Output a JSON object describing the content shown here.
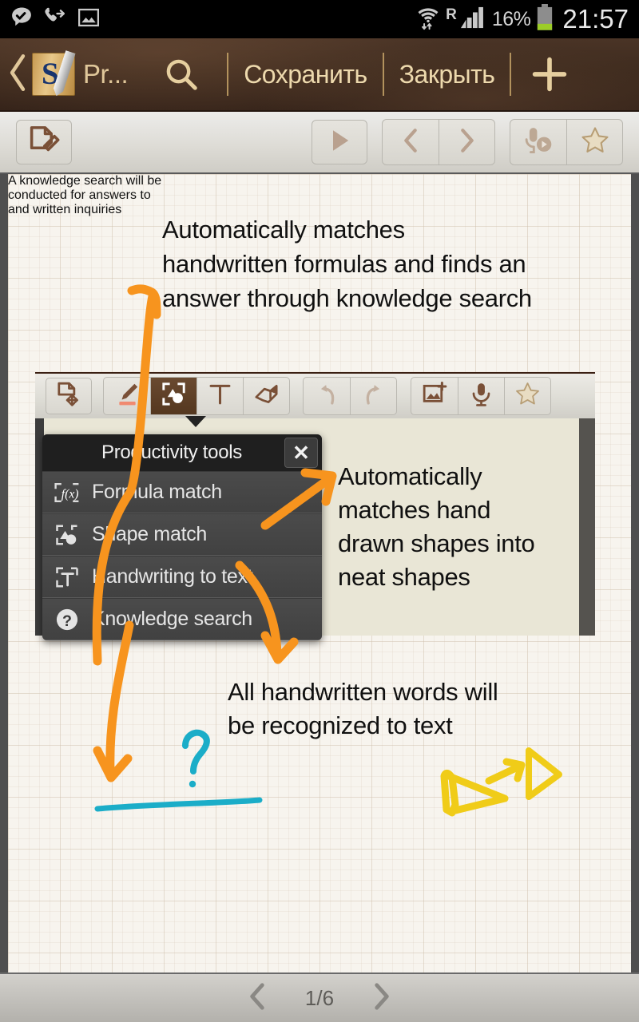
{
  "status_bar": {
    "icons_left": [
      "message-check-icon",
      "outgoing-call-icon",
      "screenshot-image-icon"
    ],
    "wifi": "wifi-transfer-icon",
    "roaming": "R",
    "signal": "signal-bars-icon",
    "battery_percent": "16%",
    "battery": "battery-low-icon",
    "time": "21:57"
  },
  "app_bar": {
    "back": "back-chevron-icon",
    "app_icon": "snote-app-icon",
    "app_letter": "S",
    "title": "Pr...",
    "search": "search-icon",
    "save_label": "Сохранить",
    "close_label": "Закрыть",
    "add": "plus-icon"
  },
  "toolbar": {
    "edit_page": "page-edit-icon",
    "play": "play-icon",
    "prev": "chevron-left-icon",
    "next": "chevron-right-icon",
    "voice_play": "voice-record-play-icon",
    "favorite": "star-icon"
  },
  "note": {
    "annotations": [
      {
        "id": "formula",
        "text": "Automatically matches\nhandwritten formulas and finds an\nanswer through knowledge search"
      },
      {
        "id": "shapes",
        "text": "Automatically\nmatches hand\ndrawn shapes into\nneat shapes"
      },
      {
        "id": "words",
        "text": "All handwritten words will\nbe recognized to text"
      },
      {
        "id": "knowledge",
        "text": "A knowledge search will be\nconducted for answers to\nand written inquiries"
      }
    ],
    "ink_colors": {
      "orange": "#f7941e",
      "cyan": "#1badc8",
      "yellow": "#f0cc18"
    },
    "drawn_marks": [
      "question-mark-ink",
      "underline-ink",
      "hand-drawn-triangle",
      "neat-triangle",
      "convert-arrow"
    ]
  },
  "embedded_screenshot": {
    "toolbar_tools": [
      {
        "name": "move-page-icon",
        "selected": false
      },
      {
        "name": "pen-icon",
        "selected": false
      },
      {
        "name": "shape-match-icon",
        "selected": true
      },
      {
        "name": "text-icon",
        "selected": false
      },
      {
        "name": "eraser-icon",
        "selected": false
      },
      {
        "name": "undo-icon",
        "selected": false
      },
      {
        "name": "redo-icon",
        "selected": false
      },
      {
        "name": "insert-image-icon",
        "selected": false
      },
      {
        "name": "microphone-icon",
        "selected": false
      },
      {
        "name": "star-icon",
        "selected": false
      }
    ],
    "popup": {
      "title": "Productivity tools",
      "close": "close-icon",
      "items": [
        {
          "label": "Formula match",
          "icon": "formula-match-icon"
        },
        {
          "label": "Shape match",
          "icon": "shape-match-icon"
        },
        {
          "label": "Handwriting to text",
          "icon": "handwriting-to-text-icon"
        },
        {
          "label": "Knowledge search",
          "icon": "knowledge-search-icon"
        }
      ]
    }
  },
  "bottom_bar": {
    "prev": "chevron-left-icon",
    "page_indicator": "1/6",
    "next": "chevron-right-icon"
  },
  "colors": {
    "app_bar_brown": "#3e2b1e",
    "app_bar_gold": "#e0c79a",
    "paper": "#f7f4ee",
    "embedded_paper": "#e9e6d6",
    "ink_orange": "#f7941e",
    "ink_cyan": "#1badc8",
    "ink_yellow": "#f0cc18"
  }
}
